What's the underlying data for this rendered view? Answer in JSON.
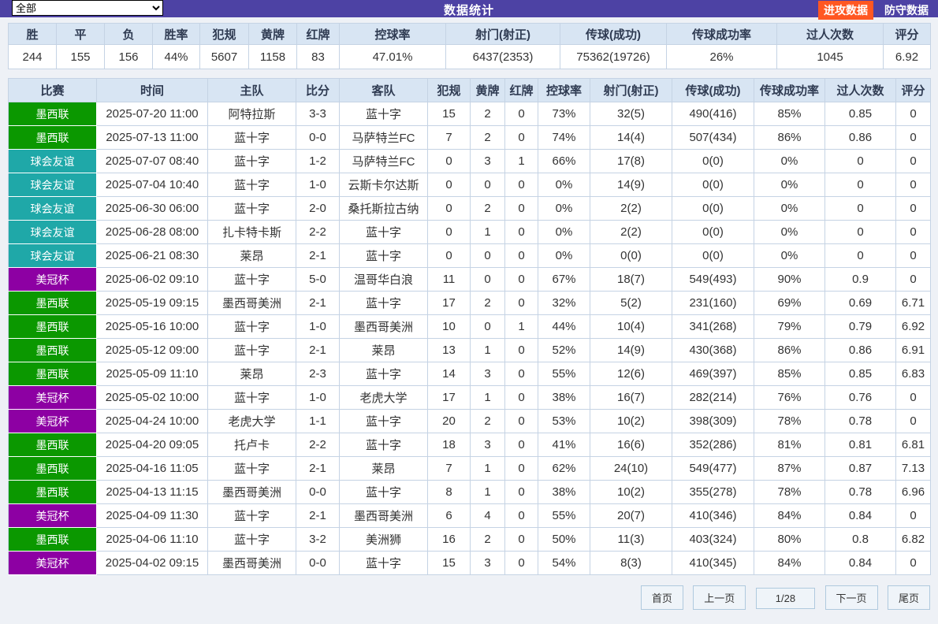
{
  "toolbar": {
    "filter_value": "全部",
    "title": "数据统计",
    "attack_button": "进攻数据",
    "defense_button": "防守数据"
  },
  "colors": {
    "topbar": "#4D42A4",
    "attack_button_bg": "#FF5722",
    "header_bg": "#D8E5F3",
    "league": {
      "墨西联": "#0B9800",
      "球会友谊": "#1FA8A8",
      "美冠杯": "#8D00A3"
    }
  },
  "summary": {
    "headers": [
      "胜",
      "平",
      "负",
      "胜率",
      "犯规",
      "黄牌",
      "红牌",
      "控球率",
      "射门(射正)",
      "传球(成功)",
      "传球成功率",
      "过人次数",
      "评分"
    ],
    "values": [
      "244",
      "155",
      "156",
      "44%",
      "5607",
      "1158",
      "83",
      "47.01%",
      "6437(2353)",
      "75362(19726)",
      "26%",
      "1045",
      "6.92"
    ]
  },
  "matches": {
    "headers": [
      "比赛",
      "时间",
      "主队",
      "比分",
      "客队",
      "犯规",
      "黄牌",
      "红牌",
      "控球率",
      "射门(射正)",
      "传球(成功)",
      "传球成功率",
      "过人次数",
      "评分"
    ],
    "rows": [
      [
        "墨西联",
        "2025-07-20 11:00",
        "阿特拉斯",
        "3-3",
        "蓝十字",
        "15",
        "2",
        "0",
        "73%",
        "32(5)",
        "490(416)",
        "85%",
        "0.85",
        "0"
      ],
      [
        "墨西联",
        "2025-07-13 11:00",
        "蓝十字",
        "0-0",
        "马萨特兰FC",
        "7",
        "2",
        "0",
        "74%",
        "14(4)",
        "507(434)",
        "86%",
        "0.86",
        "0"
      ],
      [
        "球会友谊",
        "2025-07-07 08:40",
        "蓝十字",
        "1-2",
        "马萨特兰FC",
        "0",
        "3",
        "1",
        "66%",
        "17(8)",
        "0(0)",
        "0%",
        "0",
        "0"
      ],
      [
        "球会友谊",
        "2025-07-04 10:40",
        "蓝十字",
        "1-0",
        "云斯卡尔达斯",
        "0",
        "0",
        "0",
        "0%",
        "14(9)",
        "0(0)",
        "0%",
        "0",
        "0"
      ],
      [
        "球会友谊",
        "2025-06-30 06:00",
        "蓝十字",
        "2-0",
        "桑托斯拉古纳",
        "0",
        "2",
        "0",
        "0%",
        "2(2)",
        "0(0)",
        "0%",
        "0",
        "0"
      ],
      [
        "球会友谊",
        "2025-06-28 08:00",
        "扎卡特卡斯",
        "2-2",
        "蓝十字",
        "0",
        "1",
        "0",
        "0%",
        "2(2)",
        "0(0)",
        "0%",
        "0",
        "0"
      ],
      [
        "球会友谊",
        "2025-06-21 08:30",
        "莱昂",
        "2-1",
        "蓝十字",
        "0",
        "0",
        "0",
        "0%",
        "0(0)",
        "0(0)",
        "0%",
        "0",
        "0"
      ],
      [
        "美冠杯",
        "2025-06-02 09:10",
        "蓝十字",
        "5-0",
        "温哥华白浪",
        "11",
        "0",
        "0",
        "67%",
        "18(7)",
        "549(493)",
        "90%",
        "0.9",
        "0"
      ],
      [
        "墨西联",
        "2025-05-19 09:15",
        "墨西哥美洲",
        "2-1",
        "蓝十字",
        "17",
        "2",
        "0",
        "32%",
        "5(2)",
        "231(160)",
        "69%",
        "0.69",
        "6.71"
      ],
      [
        "墨西联",
        "2025-05-16 10:00",
        "蓝十字",
        "1-0",
        "墨西哥美洲",
        "10",
        "0",
        "1",
        "44%",
        "10(4)",
        "341(268)",
        "79%",
        "0.79",
        "6.92"
      ],
      [
        "墨西联",
        "2025-05-12 09:00",
        "蓝十字",
        "2-1",
        "莱昂",
        "13",
        "1",
        "0",
        "52%",
        "14(9)",
        "430(368)",
        "86%",
        "0.86",
        "6.91"
      ],
      [
        "墨西联",
        "2025-05-09 11:10",
        "莱昂",
        "2-3",
        "蓝十字",
        "14",
        "3",
        "0",
        "55%",
        "12(6)",
        "469(397)",
        "85%",
        "0.85",
        "6.83"
      ],
      [
        "美冠杯",
        "2025-05-02 10:00",
        "蓝十字",
        "1-0",
        "老虎大学",
        "17",
        "1",
        "0",
        "38%",
        "16(7)",
        "282(214)",
        "76%",
        "0.76",
        "0"
      ],
      [
        "美冠杯",
        "2025-04-24 10:00",
        "老虎大学",
        "1-1",
        "蓝十字",
        "20",
        "2",
        "0",
        "53%",
        "10(2)",
        "398(309)",
        "78%",
        "0.78",
        "0"
      ],
      [
        "墨西联",
        "2025-04-20 09:05",
        "托卢卡",
        "2-2",
        "蓝十字",
        "18",
        "3",
        "0",
        "41%",
        "16(6)",
        "352(286)",
        "81%",
        "0.81",
        "6.81"
      ],
      [
        "墨西联",
        "2025-04-16 11:05",
        "蓝十字",
        "2-1",
        "莱昂",
        "7",
        "1",
        "0",
        "62%",
        "24(10)",
        "549(477)",
        "87%",
        "0.87",
        "7.13"
      ],
      [
        "墨西联",
        "2025-04-13 11:15",
        "墨西哥美洲",
        "0-0",
        "蓝十字",
        "8",
        "1",
        "0",
        "38%",
        "10(2)",
        "355(278)",
        "78%",
        "0.78",
        "6.96"
      ],
      [
        "美冠杯",
        "2025-04-09 11:30",
        "蓝十字",
        "2-1",
        "墨西哥美洲",
        "6",
        "4",
        "0",
        "55%",
        "20(7)",
        "410(346)",
        "84%",
        "0.84",
        "0"
      ],
      [
        "墨西联",
        "2025-04-06 11:10",
        "蓝十字",
        "3-2",
        "美洲狮",
        "16",
        "2",
        "0",
        "50%",
        "11(3)",
        "403(324)",
        "80%",
        "0.8",
        "6.82"
      ],
      [
        "美冠杯",
        "2025-04-02 09:15",
        "墨西哥美洲",
        "0-0",
        "蓝十字",
        "15",
        "3",
        "0",
        "54%",
        "8(3)",
        "410(345)",
        "84%",
        "0.84",
        "0"
      ]
    ]
  },
  "pagination": {
    "first": "首页",
    "prev": "上一页",
    "page": "1/28",
    "next": "下一页",
    "last": "尾页"
  }
}
